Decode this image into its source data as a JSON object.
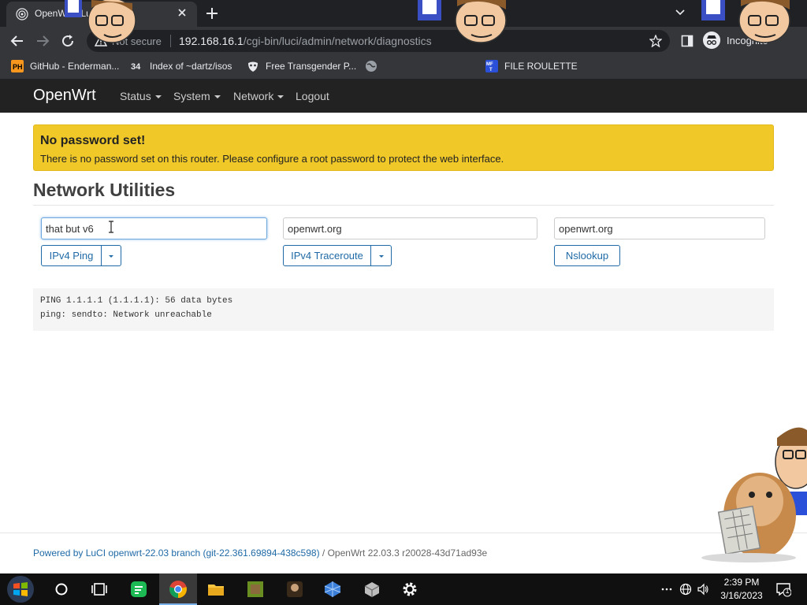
{
  "browser": {
    "tab_title": "OpenWrt - LuCI",
    "url_security_label": "Not secure",
    "url_host": "192.168.16.1",
    "url_path": "/cgi-bin/luci/admin/network/diagnostics",
    "incognito_label": "Incognito",
    "bookmarks": [
      {
        "label": "GitHub - Enderman...",
        "icon": "ph-icon"
      },
      {
        "label": "Index of ~dartz/isos",
        "icon": "34-icon"
      },
      {
        "label": "Free Transgender P...",
        "icon": "mask-icon"
      },
      {
        "label": "",
        "icon": "globe-icon"
      },
      {
        "label": "FILE ROULETTE",
        "icon": "mft-icon"
      }
    ]
  },
  "navbar": {
    "brand": "OpenWrt",
    "menu": [
      {
        "label": "Status",
        "has_dropdown": true
      },
      {
        "label": "System",
        "has_dropdown": true
      },
      {
        "label": "Network",
        "has_dropdown": true
      },
      {
        "label": "Logout",
        "has_dropdown": false
      }
    ]
  },
  "alert": {
    "title": "No password set!",
    "text": "There is no password set on this router. Please configure a root password to protect the web interface."
  },
  "page": {
    "title": "Network Utilities",
    "tools": [
      {
        "input_value": "that but v6",
        "button_label": "IPv4 Ping",
        "has_dropdown": true
      },
      {
        "input_value": "openwrt.org",
        "button_label": "IPv4 Traceroute",
        "has_dropdown": true
      },
      {
        "input_value": "openwrt.org",
        "button_label": "Nslookup",
        "has_dropdown": false
      }
    ],
    "output_lines": [
      "PING 1.1.1.1 (1.1.1.1): 56 data bytes",
      "ping: sendto: Network unreachable"
    ]
  },
  "footer": {
    "luci_link": "Powered by LuCI openwrt-22.03 branch (git-22.361.69894-438c598)",
    "separator": " / ",
    "version": "OpenWrt 22.03.3 r20028-43d71ad93e"
  },
  "taskbar": {
    "time": "2:39 PM",
    "date": "3/16/2023",
    "notification_count": "1"
  },
  "colors": {
    "navbar": "#222222",
    "alert": "#f0c929",
    "link": "#1f6aa6",
    "chrome_dark": "#202124"
  }
}
